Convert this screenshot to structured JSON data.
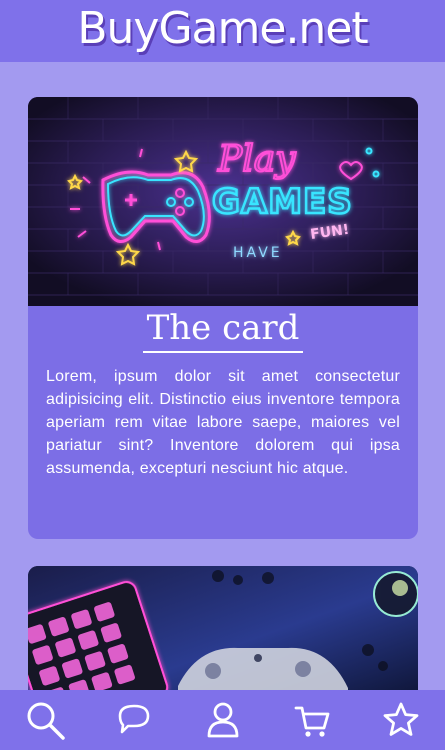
{
  "header": {
    "brand": "BuyGame.net"
  },
  "card1": {
    "title": "The card",
    "text": "Lorem, ipsum dolor sit amet consectetur adipisicing elit. Distinctio eius inventore tempora aperiam rem vitae labore saepe, maiores vel pariatur sint? Inventore dolorem qui ipsa assumenda, excepturi nesciunt hic atque.",
    "image": {
      "logo_lettering": [
        "Play",
        "GAMES",
        "HAVE",
        "FUN!"
      ]
    }
  },
  "bottom_nav": {
    "items": [
      {
        "name": "search",
        "icon": "search-icon"
      },
      {
        "name": "chat",
        "icon": "chat-icon"
      },
      {
        "name": "profile",
        "icon": "user-icon"
      },
      {
        "name": "cart",
        "icon": "cart-icon"
      },
      {
        "name": "favorites",
        "icon": "star-icon"
      }
    ]
  },
  "colors": {
    "page_bg": "#a39af0",
    "bar_bg": "#7f71ea",
    "card_bg": "#7c6ee6",
    "text": "#ffffff"
  }
}
